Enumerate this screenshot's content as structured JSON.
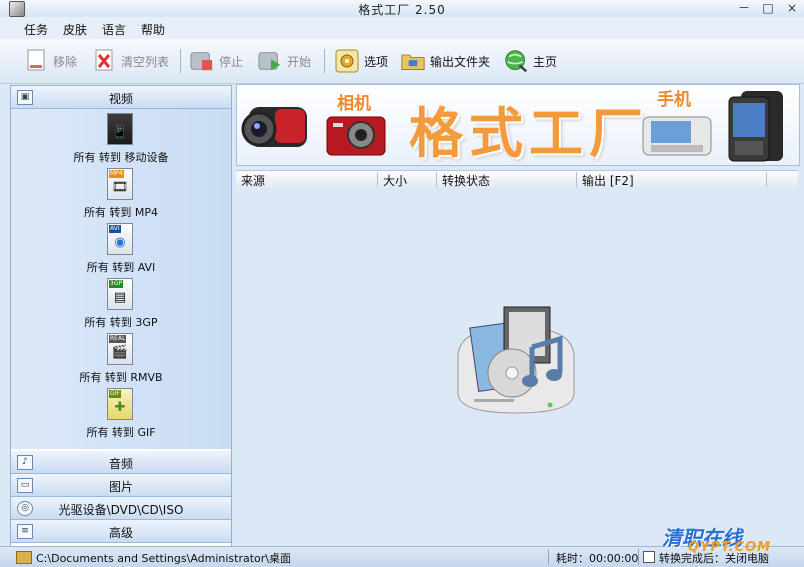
{
  "window": {
    "title": "格式工厂  2.50",
    "minimize": "－",
    "maximize": "□",
    "close": "×"
  },
  "menu": [
    "任务",
    "皮肤",
    "语言",
    "帮助"
  ],
  "toolbar": {
    "remove": "移除",
    "clear_list": "清空列表",
    "stop": "停止",
    "start": "开始",
    "options": "选项",
    "output_folder": "输出文件夹",
    "home": "主页"
  },
  "sidebar": {
    "video": "视频",
    "video_items": [
      {
        "label": "所有 转到 移动设备",
        "tag": "",
        "glyph": "📱"
      },
      {
        "label": "所有 转到 MP4",
        "tag": "MP4",
        "glyph": "🎞"
      },
      {
        "label": "所有 转到 AVI",
        "tag": "AVI",
        "glyph": "◉"
      },
      {
        "label": "所有 转到 3GP",
        "tag": "3GP",
        "glyph": "▤"
      },
      {
        "label": "所有 转到 RMVB",
        "tag": "REAL",
        "glyph": "🎬"
      },
      {
        "label": "所有 转到 GIF",
        "tag": "GIF",
        "glyph": "✚"
      }
    ],
    "audio": "音频",
    "picture": "图片",
    "rom": "光驱设备\\DVD\\CD\\ISO",
    "advanced": "高级"
  },
  "banner": {
    "camera_label": "相机",
    "brand": "格式工厂",
    "phone_label": "手机"
  },
  "list": {
    "columns": [
      "来源",
      "大小",
      "转换状态",
      "输出 [F2]"
    ]
  },
  "status": {
    "path": "C:\\Documents and Settings\\Administrator\\桌面",
    "elapsed": "耗时：00:00:00",
    "shutdown": "转换完成后：关闭电脑"
  },
  "watermark": {
    "cn": "清职在线",
    "en": "QYPT.COM"
  },
  "colors": {
    "brand": "#f39a3a",
    "accent": "#2a6fd4",
    "panel": "#dce8f6"
  }
}
